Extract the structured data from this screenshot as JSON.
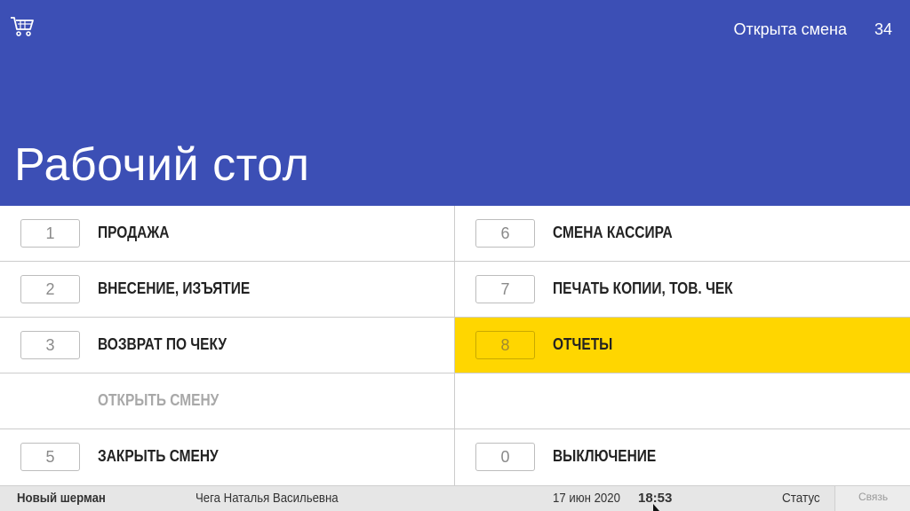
{
  "header": {
    "cart_icon": "shopping-cart-icon",
    "shift_status": "Открыта смена",
    "shift_number": "34",
    "title": "Рабочий стол",
    "background_color": "#3c4fb5"
  },
  "menu": {
    "left": [
      {
        "key": "1",
        "label": "ПРОДАЖА"
      },
      {
        "key": "2",
        "label": "ВНЕСЕНИЕ, ИЗЪЯТИЕ"
      },
      {
        "key": "3",
        "label": "ВОЗВРАТ ПО ЧЕКУ"
      },
      {
        "key": "",
        "label": "ОТКРЫТЬ СМЕНУ"
      },
      {
        "key": "5",
        "label": "ЗАКРЫТЬ СМЕНУ"
      }
    ],
    "right": [
      {
        "key": "6",
        "label": "СМЕНА КАССИРА"
      },
      {
        "key": "7",
        "label": "ПЕЧАТЬ КОПИИ, ТОВ. ЧЕК"
      },
      {
        "key": "8",
        "label": "ОТЧЕТЫ"
      },
      {
        "key": "",
        "label": ""
      },
      {
        "key": "0",
        "label": "ВЫКЛЮЧЕНИЕ"
      }
    ],
    "highlight_color": "#ffd600"
  },
  "status_bar": {
    "store": "Новый шерман",
    "cashier": "Чега Наталья Васильевна",
    "date": "17 июн 2020",
    "time": "18:53",
    "status_label": "Статус",
    "connection_label": "Связь"
  }
}
